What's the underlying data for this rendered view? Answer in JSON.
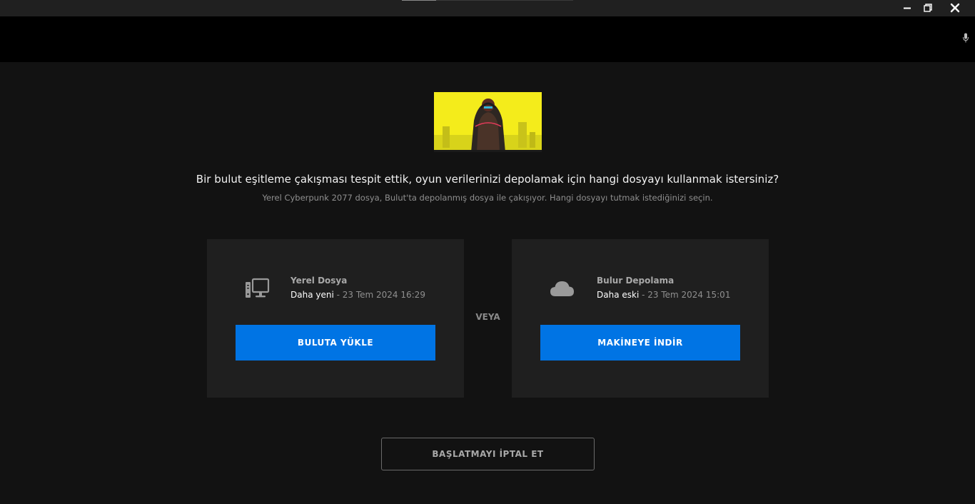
{
  "colors": {
    "accent": "#0074e4",
    "background": "#121212",
    "card": "#1f1f1f",
    "titlebar": "#202020"
  },
  "icons": {
    "minimize": "minimize-icon",
    "restore": "restore-icon",
    "close": "close-icon",
    "microphone": "microphone-icon",
    "local": "desktop-computer-icon",
    "cloud": "cloud-icon"
  },
  "dialog": {
    "headline": "Bir bulut eşitleme çakışması tespit ettik, oyun verilerinizi depolamak için hangi dosyayı kullanmak istersiniz?",
    "subline": "Yerel Cyberpunk 2077 dosya, Bulut'ta depolanmış dosya ile çakışıyor. Hangi dosyayı tutmak istediğinizi seçin.",
    "or_label": "VEYA",
    "local": {
      "title": "Yerel Dosya",
      "status": "Daha yeni",
      "date": " - 23 Tem 2024 16:29",
      "button": "BULUTA YÜKLE"
    },
    "cloud": {
      "title": "Bulur Depolama",
      "status": "Daha eski",
      "date": " - 23 Tem 2024 15:01",
      "button": "MAKİNEYE İNDİR"
    },
    "cancel": "BAŞLATMAYI İPTAL ET"
  }
}
